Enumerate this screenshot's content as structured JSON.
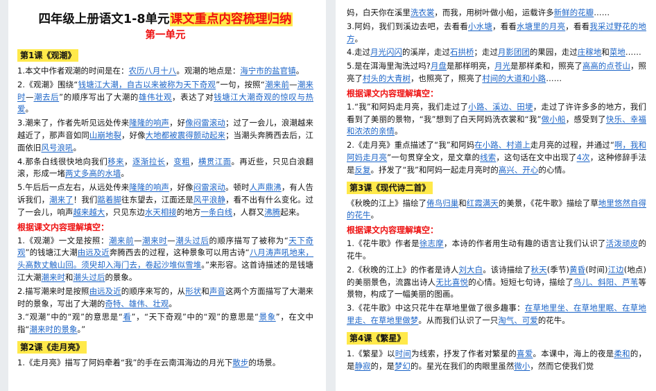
{
  "title": {
    "plain": "四年级上册语文1-8单元",
    "highlight": "课文重点内容梳理归纳"
  },
  "unit1": "第一单元",
  "left_blocks": [
    {
      "type": "lesson",
      "text": "第1课《观潮》"
    },
    {
      "type": "para",
      "segments": [
        [
          "1.本文中作者观潮的时间是在：",
          0
        ],
        [
          "农历八月十八",
          1
        ],
        [
          "。观潮的地点是：",
          0
        ],
        [
          "海宁市的盐官镇",
          1
        ],
        [
          "。",
          0
        ]
      ]
    },
    {
      "type": "para",
      "segments": [
        [
          "2.《观潮》围绕“",
          0
        ],
        [
          "钱塘江大潮，自古以来被称为天下奇观",
          1
        ],
        [
          "”一句，按照“",
          0
        ],
        [
          "潮来前",
          1
        ],
        [
          "—",
          0
        ],
        [
          "潮来时",
          1
        ],
        [
          "—",
          0
        ],
        [
          "潮去后",
          1
        ],
        [
          "”的顺序写出了大潮的",
          0
        ],
        [
          "雄伟壮观",
          1
        ],
        [
          "，表达了对",
          0
        ],
        [
          "钱塘江大潮奇观的惊叹与热爱",
          1
        ],
        [
          "。",
          0
        ]
      ]
    },
    {
      "type": "para",
      "segments": [
        [
          "3.潮来了，作者先听见远处传来",
          0
        ],
        [
          "隆隆的响声",
          1
        ],
        [
          "，好",
          0
        ],
        [
          "像闷雷滚动",
          1
        ],
        [
          "；过了一会儿，浪潮越来越近了，那声音如同",
          0
        ],
        [
          "山崩地裂",
          1
        ],
        [
          "，好像",
          0
        ],
        [
          "大地都被震得颤动起来",
          1
        ],
        [
          "；当潮头奔腾西去后，江面依旧",
          0
        ],
        [
          "风号浪吼",
          1
        ],
        [
          "。",
          0
        ]
      ]
    },
    {
      "type": "para",
      "segments": [
        [
          "4.那条白线很快地向我们",
          0
        ],
        [
          "移来",
          1
        ],
        [
          "，",
          0
        ],
        [
          "逐渐拉长",
          1
        ],
        [
          "，",
          0
        ],
        [
          "变粗",
          1
        ],
        [
          "，",
          0
        ],
        [
          "横贯江面",
          1
        ],
        [
          "。再近些，只见白浪翻滚，形成一堵",
          0
        ],
        [
          "两丈多高的水墙",
          1
        ],
        [
          "。",
          0
        ]
      ]
    },
    {
      "type": "para",
      "segments": [
        [
          "5.午后后一点左右，从远处传来",
          0
        ],
        [
          "隆隆的响声",
          1
        ],
        [
          "，好像",
          0
        ],
        [
          "闷雷滚动",
          1
        ],
        [
          "。顿时",
          0
        ],
        [
          "人声鼎沸",
          1
        ],
        [
          "，有人告诉我们，",
          0
        ],
        [
          "潮来了",
          1
        ],
        [
          "！我们",
          0
        ],
        [
          "踮着脚",
          1
        ],
        [
          "往东望去，江面还是",
          0
        ],
        [
          "风平浪静",
          1
        ],
        [
          "，看不出有什么变化。过了一会儿，响声",
          0
        ],
        [
          "越来越大",
          1
        ],
        [
          "，只见东边",
          0
        ],
        [
          "水天相接",
          1
        ],
        [
          "的地方",
          0
        ],
        [
          "一条白线",
          1
        ],
        [
          "，人群又",
          0
        ],
        [
          "沸腾",
          1
        ],
        [
          "起来。",
          0
        ]
      ]
    },
    {
      "type": "section",
      "text": "根据课文内容理解填空："
    },
    {
      "type": "para",
      "segments": [
        [
          "1.《观潮》一文是按照：",
          0
        ],
        [
          "潮来前",
          1
        ],
        [
          "—",
          0
        ],
        [
          "潮来时",
          1
        ],
        [
          "—",
          0
        ],
        [
          "潮头过后",
          1
        ],
        [
          "的顺序描写了被称为“",
          0
        ],
        [
          "天下奇观",
          1
        ],
        [
          "”的钱塘江大潮",
          0
        ],
        [
          "由远及近",
          1
        ],
        [
          "奔腾西去的过程，这种景象可以用古诗“",
          0
        ],
        [
          "八月涛声吼地来，头高数丈触山回。须臾却入海门去，卷起沙堆似雪堆",
          1
        ],
        [
          "。”来形容。这首诗描述的是钱塘江大潮",
          0
        ],
        [
          "潮来时",
          1
        ],
        [
          "和",
          0
        ],
        [
          "潮头过后",
          1
        ],
        [
          "的景象。",
          0
        ]
      ]
    },
    {
      "type": "para",
      "segments": [
        [
          "2.描写潮来时是按照",
          0
        ],
        [
          "由远及近",
          1
        ],
        [
          "的顺序来写的，从",
          0
        ],
        [
          "形状",
          1
        ],
        [
          "和",
          0
        ],
        [
          "声音",
          1
        ],
        [
          "这两个方面描写了大潮来时的景象，写出了大潮的",
          0
        ],
        [
          "奇特、雄伟、壮观",
          1
        ],
        [
          "。",
          0
        ]
      ]
    },
    {
      "type": "para",
      "segments": [
        [
          "3.“观潮”中的“观”的意思是“",
          0
        ],
        [
          "看",
          1
        ],
        [
          "”，“天下奇观”中的“观”的意思是“",
          0
        ],
        [
          "景象",
          1
        ],
        [
          "”，在文中指“",
          0
        ],
        [
          "潮来时的景象",
          1
        ],
        [
          "。”",
          0
        ]
      ]
    },
    {
      "type": "lesson",
      "text": "第2课《走月亮》"
    },
    {
      "type": "para",
      "segments": [
        [
          "1.《走月亮》描写了阿妈牵着“我”的手在云南洱海边的月光下",
          0
        ],
        [
          "散步",
          1
        ],
        [
          "的场景。",
          0
        ]
      ]
    }
  ],
  "right_blocks": [
    {
      "type": "para",
      "segments": [
        [
          "妈，白天你在溪里",
          0
        ],
        [
          "洗衣裳",
          1
        ],
        [
          "，而我，用树叶做小船，运载许多",
          0
        ],
        [
          "新鲜的花瓣",
          1
        ],
        [
          "……",
          0
        ]
      ]
    },
    {
      "type": "para",
      "segments": [
        [
          "3.阿妈，我们到溪边去吧，去看看",
          0
        ],
        [
          "小水塘",
          1
        ],
        [
          "，看看",
          0
        ],
        [
          "水塘里的月亮",
          1
        ],
        [
          "，看看",
          0
        ],
        [
          "我采过野花的地方",
          1
        ],
        [
          "。",
          0
        ]
      ]
    },
    {
      "type": "para",
      "segments": [
        [
          "4.走过",
          0
        ],
        [
          "月光闪闪",
          1
        ],
        [
          "的溪岸，走过",
          0
        ],
        [
          "石拱桥",
          1
        ],
        [
          "；走过",
          0
        ],
        [
          "月影团团",
          1
        ],
        [
          "的果园，走过",
          0
        ],
        [
          "庄稼地",
          1
        ],
        [
          "和",
          0
        ],
        [
          "菜地",
          1
        ],
        [
          "……",
          0
        ]
      ]
    },
    {
      "type": "para",
      "segments": [
        [
          "5.是在洱海里淘洗过吗?",
          0
        ],
        [
          "月盘",
          1
        ],
        [
          "是那样明亮，",
          0
        ],
        [
          "月光",
          1
        ],
        [
          "是那样柔和，照亮了",
          0
        ],
        [
          "高高的点苍山",
          1
        ],
        [
          "，照亮了",
          0
        ],
        [
          "村头的大青树",
          1
        ],
        [
          "，也照亮了，照亮了",
          0
        ],
        [
          "村间的大道和小路",
          1
        ],
        [
          "……",
          0
        ]
      ]
    },
    {
      "type": "section",
      "text": "根据课文内容理解填空："
    },
    {
      "type": "para",
      "segments": [
        [
          "1.“我”和阿妈走月亮，我们走过了",
          0
        ],
        [
          "小路、溪边、田埂",
          1
        ],
        [
          "，走过了许许多多的地方，我们看到了美丽的景物，“我”想到了白天阿妈洗衣裳和“我”",
          0
        ],
        [
          "做小船",
          1
        ],
        [
          "，感受到了",
          0
        ],
        [
          "快乐、幸福和浓浓的亲情",
          1
        ],
        [
          "。",
          0
        ]
      ]
    },
    {
      "type": "para",
      "segments": [
        [
          "2.《走月亮》重点描述了“我”和阿妈",
          0
        ],
        [
          "在小路、村道上",
          1
        ],
        [
          "走月亮的过程，并通过“",
          0
        ],
        [
          "啊，我和阿妈走月亮",
          1
        ],
        [
          "”一句贯穿全文，是文章的",
          0
        ],
        [
          "线索",
          1
        ],
        [
          "，这句话在文中出现了",
          0
        ],
        [
          "4次",
          1
        ],
        [
          "，这种修辞手法是",
          0
        ],
        [
          "反复",
          1
        ],
        [
          "。抒发了“我”和阿妈一起走月亮时的",
          0
        ],
        [
          "高兴、开心",
          1
        ],
        [
          "的心情。",
          0
        ]
      ]
    },
    {
      "type": "lesson",
      "text": "第3课《现代诗二首》"
    },
    {
      "type": "para",
      "segments": [
        [
          "《秋晚的江上》描绘了",
          0
        ],
        [
          "倦鸟归巢",
          1
        ],
        [
          "和",
          0
        ],
        [
          "红霞满天",
          1
        ],
        [
          "的美景，《花牛歌》描绘了草",
          0
        ],
        [
          "地里悠然自得的花牛",
          1
        ],
        [
          "。",
          0
        ]
      ]
    },
    {
      "type": "section",
      "text": "根据课文内容理解填空："
    },
    {
      "type": "para",
      "segments": [
        [
          "1.《花牛歌》作者是",
          0
        ],
        [
          "徐志摩",
          1
        ],
        [
          "，本诗的作者用生动有趣的语言让我们认识了",
          0
        ],
        [
          "活泼顽皮",
          1
        ],
        [
          "的花牛。",
          0
        ]
      ]
    },
    {
      "type": "para",
      "segments": [
        [
          "2.《秋晚的江上》的作者是诗人",
          0
        ],
        [
          "刘大白",
          1
        ],
        [
          "。该诗描绘了",
          0
        ],
        [
          "秋天",
          1
        ],
        [
          "(季节)",
          0
        ],
        [
          "黄昏",
          1
        ],
        [
          "(时间)",
          0
        ],
        [
          "江边",
          1
        ],
        [
          "(地点)的美丽景色，流露出诗人",
          0
        ],
        [
          "无比喜悦",
          1
        ],
        [
          "的心情。短短七句诗，描绘了",
          0
        ],
        [
          "鸟儿、斜阳、芦苇",
          1
        ],
        [
          "等景物，构成了一幅美丽的图画。",
          0
        ]
      ]
    },
    {
      "type": "para",
      "segments": [
        [
          "3.《花牛歌》中这只花牛在草地里做了很多趣事：",
          0
        ],
        [
          "在草地里坐、在草地里眠、在草地里走、在草地里做梦",
          1
        ],
        [
          "。从而我们认识了一只",
          0
        ],
        [
          "淘气、可爱",
          1
        ],
        [
          "的花牛。",
          0
        ]
      ]
    },
    {
      "type": "lesson",
      "text": "第4课《繁星》"
    },
    {
      "type": "para",
      "segments": [
        [
          "1.《繁星》以",
          0
        ],
        [
          "时间",
          1
        ],
        [
          "为线索，抒发了作者对繁星的",
          0
        ],
        [
          "喜爱",
          1
        ],
        [
          "。本课中，海上的夜是",
          0
        ],
        [
          "柔和",
          1
        ],
        [
          "的，是",
          0
        ],
        [
          "静寂",
          1
        ],
        [
          "的，是",
          0
        ],
        [
          "梦幻",
          1
        ],
        [
          "的。星光在我们的肉眼里虽然",
          0
        ],
        [
          "微小",
          1
        ],
        [
          "，然而它使我们觉",
          0
        ]
      ]
    }
  ]
}
